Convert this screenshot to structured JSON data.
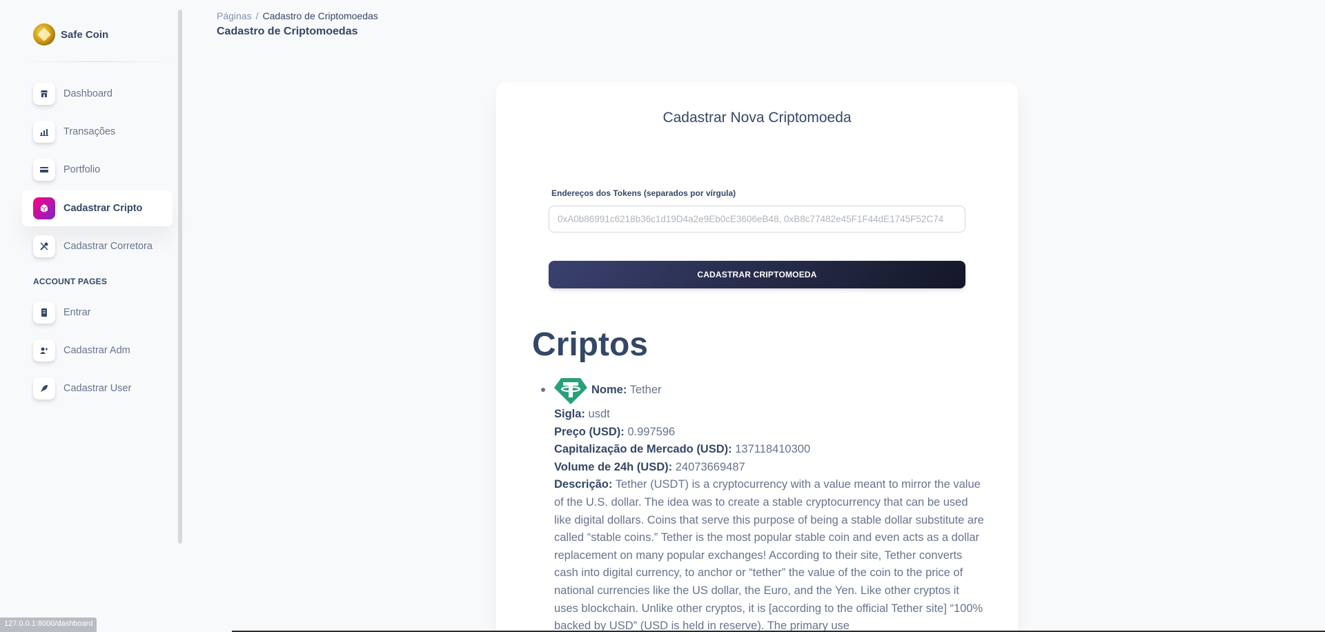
{
  "brand": {
    "name": "Safe Coin"
  },
  "sidebar": {
    "items": [
      {
        "label": "Dashboard",
        "icon": "shop-icon"
      },
      {
        "label": "Transações",
        "icon": "chart-icon"
      },
      {
        "label": "Portfolio",
        "icon": "credit-card-icon"
      },
      {
        "label": "Cadastrar Cripto",
        "icon": "cube-icon",
        "active": true
      },
      {
        "label": "Cadastrar Corretora",
        "icon": "tools-icon"
      }
    ],
    "section_title": "ACCOUNT PAGES",
    "account_items": [
      {
        "label": "Entrar",
        "icon": "document-icon"
      },
      {
        "label": "Cadastrar Adm",
        "icon": "user-add-icon"
      },
      {
        "label": "Cadastrar User",
        "icon": "rocket-icon"
      }
    ]
  },
  "header": {
    "breadcrumb_root": "Páginas",
    "breadcrumb_separator": "/",
    "breadcrumb_current": "Cadastro de Criptomoedas",
    "title": "Cadastro de Criptomoedas"
  },
  "form": {
    "title": "Cadastrar Nova Criptomoeda",
    "tokens_label": "Endereços dos Tokens (separados por vírgula)",
    "tokens_placeholder": "0xA0b86991c6218b36c1d19D4a2e9Eb0cE3606eB48, 0xB8c77482e45F1F44dE1745F52C74",
    "tokens_value": "",
    "submit_label": "CADASTRAR CRIPTOMOEDA"
  },
  "cryptos": {
    "heading": "Criptos",
    "items": [
      {
        "name_label": "Nome:",
        "name": "Tether",
        "symbol_label": "Sigla:",
        "symbol": "usdt",
        "price_label": "Preço (USD):",
        "price": "0.997596",
        "market_cap_label": "Capitalização de Mercado (USD):",
        "market_cap": "137118410300",
        "volume_label": "Volume de 24h (USD):",
        "volume": "24073669487",
        "description_label": "Descrição:",
        "description": "Tether (USDT) is a cryptocurrency with a value meant to mirror the value of the U.S. dollar. The idea was to create a stable cryptocurrency that can be used like digital dollars. Coins that serve this purpose of being a stable dollar substitute are called “stable coins.” Tether is the most popular stable coin and even acts as a dollar replacement on many popular exchanges! According to their site, Tether converts cash into digital currency, to anchor or “tether” the value of the coin to the price of national currencies like the US dollar, the Euro, and the Yen. Like other cryptos it uses blockchain. Unlike other cryptos, it is [according to the official Tether site] “100% backed by USD” (USD is held in reserve). The primary use"
      }
    ]
  },
  "status_bar": {
    "url": "127.0.0.1:8000/dashboard"
  },
  "colors": {
    "primary_text": "#344767",
    "secondary_text": "#67748e",
    "active_icon_gradient_start": "#7928ca",
    "active_icon_gradient_end": "#ff0080",
    "button_gradient_start": "#141727",
    "button_gradient_end": "#3a416f",
    "tether_green": "#26a17b"
  }
}
